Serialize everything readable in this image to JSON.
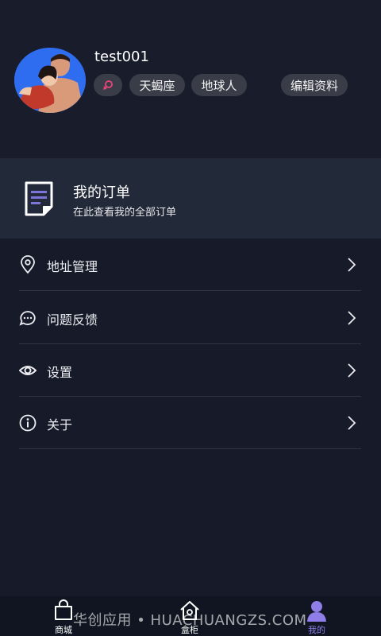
{
  "profile": {
    "username": "test001",
    "tags": {
      "zodiac": "天蝎座",
      "planet": "地球人"
    },
    "edit_label": "编辑资料",
    "gender_icon": "female-symbol-icon"
  },
  "order": {
    "title": "我的订单",
    "subtitle": "在此查看我的全部订单",
    "icon": "document-icon"
  },
  "menu": [
    {
      "label": "地址管理",
      "icon": "location-pin-icon"
    },
    {
      "label": "问题反馈",
      "icon": "chat-bubble-icon"
    },
    {
      "label": "设置",
      "icon": "eye-icon"
    },
    {
      "label": "关于",
      "icon": "info-icon"
    }
  ],
  "tabs": [
    {
      "label": "商城",
      "icon": "shopping-bag-icon"
    },
    {
      "label": "盒柜",
      "icon": "house-icon"
    },
    {
      "label": "我的",
      "icon": "person-icon",
      "active": true
    }
  ],
  "watermark": "华创应用 • HUACHUANGZS.COM",
  "colors": {
    "background": "#161a29",
    "order_card": "#222938",
    "tag_bg": "#3a3d47",
    "accent": "#8f7de8",
    "avatar_bg": "#2f6df0",
    "gender_icon": "#e8457a"
  }
}
